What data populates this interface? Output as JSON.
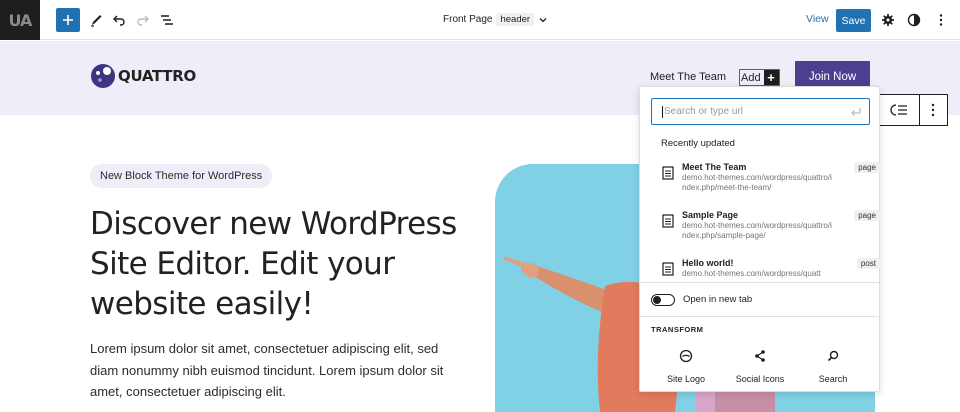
{
  "colors": {
    "accent": "#2271b1",
    "header_bg": "#eeedf8",
    "cta": "#4b3f8f",
    "hero_image": "#80d0e6"
  },
  "topbar": {
    "site_icon_text": "UA",
    "add_label": "+",
    "document": {
      "title": "Front Page",
      "part": "header"
    },
    "view_label": "View",
    "save_label": "Save"
  },
  "header": {
    "logo_text": "QUATTRO",
    "nav": [
      {
        "label": "Meet The Team"
      }
    ],
    "add_label": "Add",
    "add_plus": "+",
    "join_label": "Join Now"
  },
  "link_popover": {
    "search_placeholder": "Search or type url",
    "recent_label": "Recently updated",
    "results": [
      {
        "title": "Meet The Team",
        "url": "demo.hot-themes.com/wordpress/quattro/index.php/meet-the-team/",
        "type": "page"
      },
      {
        "title": "Sample Page",
        "url": "demo.hot-themes.com/wordpress/quattro/index.php/sample-page/",
        "type": "page"
      },
      {
        "title": "Hello world!",
        "url": "demo.hot-themes.com/wordpress/quatt",
        "type": "post"
      }
    ],
    "open_new_tab_label": "Open in new tab",
    "open_new_tab_on": false,
    "transform_label": "TRANSFORM",
    "transforms": [
      {
        "label": "Site Logo",
        "icon": "site-logo-icon"
      },
      {
        "label": "Social Icons",
        "icon": "share-icon"
      },
      {
        "label": "Search",
        "icon": "search-icon"
      }
    ]
  },
  "hero": {
    "badge": "New Block Theme for WordPress",
    "title": "Discover new WordPress Site Editor. Edit your website easily!",
    "text": "Lorem ipsum dolor sit amet, consectetuer adipiscing elit, sed diam nonummy nibh euismod tincidunt. Lorem ipsum dolor sit amet, consectetuer adipiscing elit."
  }
}
